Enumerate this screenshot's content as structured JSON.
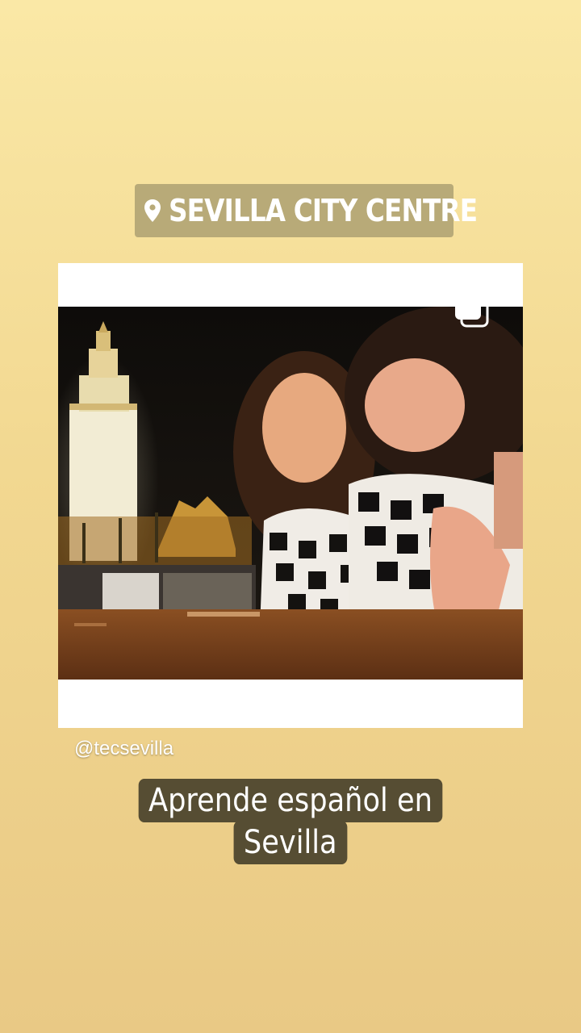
{
  "story": {
    "location_sticker": {
      "icon": "location-pin-icon",
      "label": "SEVILLA CITY CENTRE"
    },
    "post": {
      "icon": "multiple-posts-icon",
      "mention": "@tecsevilla"
    },
    "caption": {
      "line1": "Aprende español en",
      "line2": "Sevilla"
    }
  },
  "colors": {
    "background_top": "#fae8a6",
    "background_bottom": "#e9c985",
    "location_sticker_bg": "#b8aa78",
    "caption_bg": "#564d33",
    "text": "#ffffff"
  }
}
